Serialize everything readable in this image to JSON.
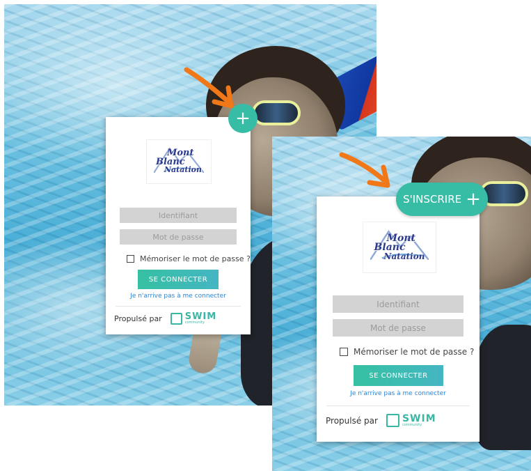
{
  "brand": {
    "logo_line1": "Mont",
    "logo_line2": "Blanc",
    "logo_line3": "Natation"
  },
  "login": {
    "username_placeholder": "Identifiant",
    "password_placeholder": "Mot de passe",
    "remember_label": "Mémoriser le mot de passe ?",
    "connect_label": "SE CONNECTER",
    "forgot_label": "Je n'arrive pas à me connecter",
    "powered_label": "Propulsé par",
    "swim_word": "SWIM",
    "swim_sub": "community"
  },
  "signup": {
    "plus_symbol": "+",
    "label": "S'INSCRIRE"
  },
  "icons": {
    "plus": "plus-icon",
    "checkbox": "checkbox-icon",
    "swim": "swim-community-logo-icon"
  },
  "colors": {
    "accent": "#37bda6",
    "arrow": "#f07818",
    "link": "#2a84d6",
    "field_bg": "#d3d3d3"
  }
}
